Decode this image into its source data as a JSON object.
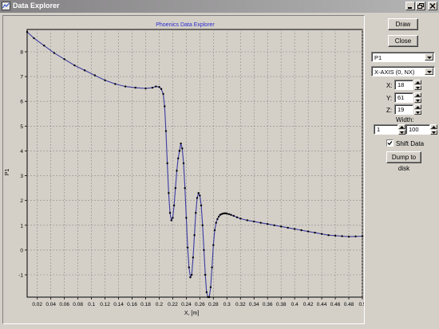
{
  "window": {
    "title": "Data Explorer"
  },
  "toolbar": {
    "draw_label": "Draw",
    "close_label": "Close",
    "dump_label": "Dump to disk"
  },
  "controls": {
    "variable": "P1",
    "direction": "X-AXIS (0, NX)",
    "x": {
      "label": "X:",
      "value": "18"
    },
    "y": {
      "label": "Y:",
      "value": "61"
    },
    "z": {
      "label": "Z:",
      "value": "19"
    },
    "width": {
      "label": "Width:",
      "from": "1",
      "to": "100"
    },
    "shift_data": {
      "label": "Shift Data",
      "checked": true
    }
  },
  "chart_data": {
    "type": "line",
    "title": "Phoenics Data Explorer",
    "xlabel": "X, [m]",
    "ylabel": "P1",
    "xlim": [
      0.005,
      0.5
    ],
    "ylim": [
      -1.9,
      8.9
    ],
    "grid": true,
    "line_color": "#3a3aa0",
    "marker_color": "#000000",
    "title_color": "#2a2ad0",
    "x_ticks": [
      0.02,
      0.04,
      0.06,
      0.08,
      0.1,
      0.12,
      0.14,
      0.16,
      0.18,
      0.2,
      0.22,
      0.24,
      0.26,
      0.28,
      0.3,
      0.32,
      0.34,
      0.36,
      0.38,
      0.4,
      0.42,
      0.44,
      0.46,
      0.48,
      0.5
    ],
    "x_tick_labels": [
      "0.02",
      "0.04",
      "0.06",
      "0.08",
      "0.1",
      "0.12",
      "0.14",
      "0.16",
      "0.18",
      "0.2",
      "0.22",
      "0.24",
      "0.26",
      "0.28",
      "0.3",
      "0.32",
      "0.34",
      "0.36",
      "0.38",
      "0.4",
      "0.42",
      "0.44",
      "0.46",
      "0.48",
      "0.5"
    ],
    "y_ticks": [
      -1,
      0,
      1,
      2,
      3,
      4,
      5,
      6,
      7,
      8
    ],
    "y_tick_labels": [
      "-1",
      "0",
      "1",
      "2",
      "3",
      "4",
      "5",
      "6",
      "7",
      "8"
    ],
    "series": [
      {
        "x": [
          0.005,
          0.015,
          0.03,
          0.045,
          0.06,
          0.075,
          0.09,
          0.105,
          0.12,
          0.135,
          0.15,
          0.165,
          0.18,
          0.19,
          0.195,
          0.2,
          0.203,
          0.206,
          0.208,
          0.21,
          0.212,
          0.214,
          0.216,
          0.218,
          0.22,
          0.222,
          0.224,
          0.226,
          0.228,
          0.23,
          0.232,
          0.234,
          0.236,
          0.238,
          0.24,
          0.242,
          0.244,
          0.246,
          0.248,
          0.25,
          0.252,
          0.254,
          0.256,
          0.258,
          0.26,
          0.262,
          0.264,
          0.266,
          0.268,
          0.27,
          0.272,
          0.274,
          0.276,
          0.278,
          0.28,
          0.282,
          0.284,
          0.286,
          0.288,
          0.29,
          0.292,
          0.294,
          0.296,
          0.298,
          0.3,
          0.303,
          0.306,
          0.31,
          0.315,
          0.32,
          0.33,
          0.34,
          0.35,
          0.36,
          0.37,
          0.38,
          0.39,
          0.4,
          0.41,
          0.42,
          0.43,
          0.44,
          0.45,
          0.46,
          0.47,
          0.48,
          0.49,
          0.5
        ],
        "y": [
          8.8,
          8.55,
          8.25,
          7.95,
          7.7,
          7.45,
          7.25,
          7.05,
          6.85,
          6.7,
          6.6,
          6.55,
          6.52,
          6.55,
          6.6,
          6.58,
          6.5,
          6.3,
          5.8,
          4.8,
          3.5,
          2.3,
          1.5,
          1.2,
          1.3,
          1.8,
          2.5,
          3.2,
          3.7,
          4.0,
          4.3,
          4.1,
          3.5,
          2.5,
          1.3,
          0.1,
          -0.7,
          -1.1,
          -1.0,
          -0.3,
          0.6,
          1.5,
          2.1,
          2.3,
          2.2,
          1.8,
          1.0,
          0.0,
          -1.0,
          -1.7,
          -1.9,
          -1.9,
          -1.5,
          -0.7,
          0.2,
          0.8,
          1.1,
          1.25,
          1.35,
          1.42,
          1.45,
          1.47,
          1.48,
          1.48,
          1.47,
          1.45,
          1.42,
          1.38,
          1.32,
          1.27,
          1.2,
          1.15,
          1.1,
          1.05,
          1.0,
          0.95,
          0.9,
          0.85,
          0.8,
          0.75,
          0.7,
          0.65,
          0.6,
          0.58,
          0.56,
          0.54,
          0.55,
          0.56
        ]
      }
    ]
  }
}
